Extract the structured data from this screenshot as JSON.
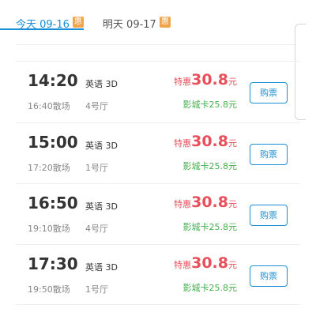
{
  "tabs": [
    {
      "label": "今天 09-16",
      "badge": "惠",
      "active": true
    },
    {
      "label": "明天 09-17",
      "badge": "惠",
      "active": false
    }
  ],
  "colors": {
    "accent": "#1b8fd6",
    "price": "#e94e5b",
    "card": "#44b04e",
    "badge": "#f1a54a"
  },
  "showtimes": [
    {
      "time": "14:20",
      "end": "16:40散场",
      "lang": "英语 3D",
      "hall": "4号厅",
      "price_label": "特惠",
      "price": "30.8",
      "price_unit": "元",
      "card": "影城卡25.8元",
      "buy": "购票"
    },
    {
      "time": "15:00",
      "end": "17:20散场",
      "lang": "英语 3D",
      "hall": "1号厅",
      "price_label": "特惠",
      "price": "30.8",
      "price_unit": "元",
      "card": "影城卡25.8元",
      "buy": "购票"
    },
    {
      "time": "16:50",
      "end": "19:10散场",
      "lang": "英语 3D",
      "hall": "4号厅",
      "price_label": "特惠",
      "price": "30.8",
      "price_unit": "元",
      "card": "影城卡25.8元",
      "buy": "购票"
    },
    {
      "time": "17:30",
      "end": "19:50散场",
      "lang": "英语 3D",
      "hall": "1号厅",
      "price_label": "特惠",
      "price": "30.8",
      "price_unit": "元",
      "card": "影城卡25.8元",
      "buy": "购票"
    }
  ]
}
